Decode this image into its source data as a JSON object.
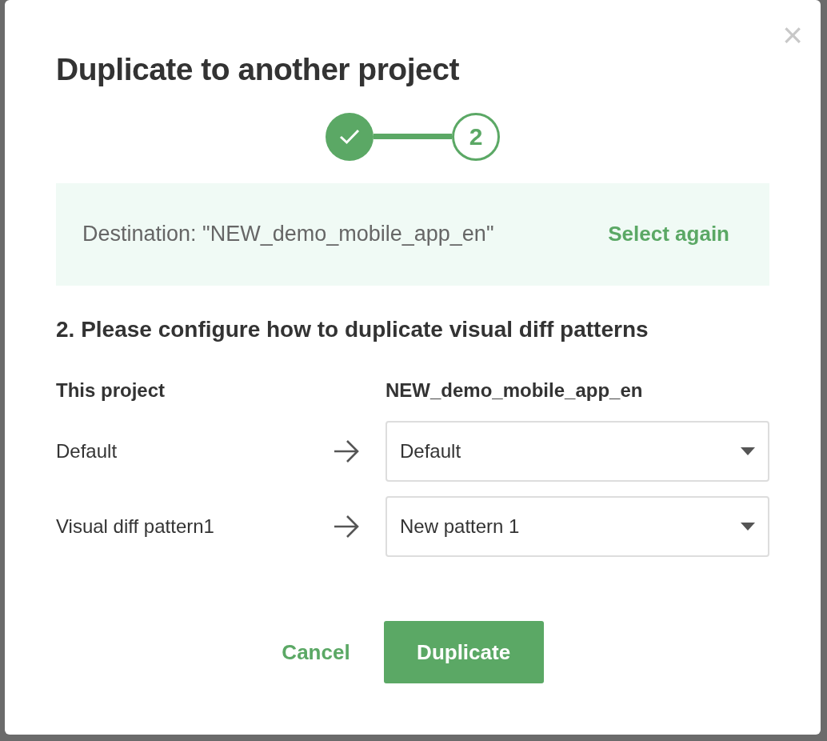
{
  "dialog": {
    "title": "Duplicate to another project",
    "close": "×"
  },
  "steps": [
    {
      "done": true
    },
    {
      "done": false,
      "number": "2"
    }
  ],
  "destination": {
    "text": "Destination: \"NEW_demo_mobile_app_en\"",
    "action": "Select again"
  },
  "section_title": "2. Please configure how to duplicate visual diff patterns",
  "columns": [
    "This project",
    "NEW_demo_mobile_app_en"
  ],
  "mappings": [
    {
      "source": "Default",
      "target": "Default"
    },
    {
      "source": "Visual diff pattern1",
      "target": "New pattern 1"
    }
  ],
  "buttons": {
    "cancel": "Cancel",
    "confirm": "Duplicate"
  }
}
